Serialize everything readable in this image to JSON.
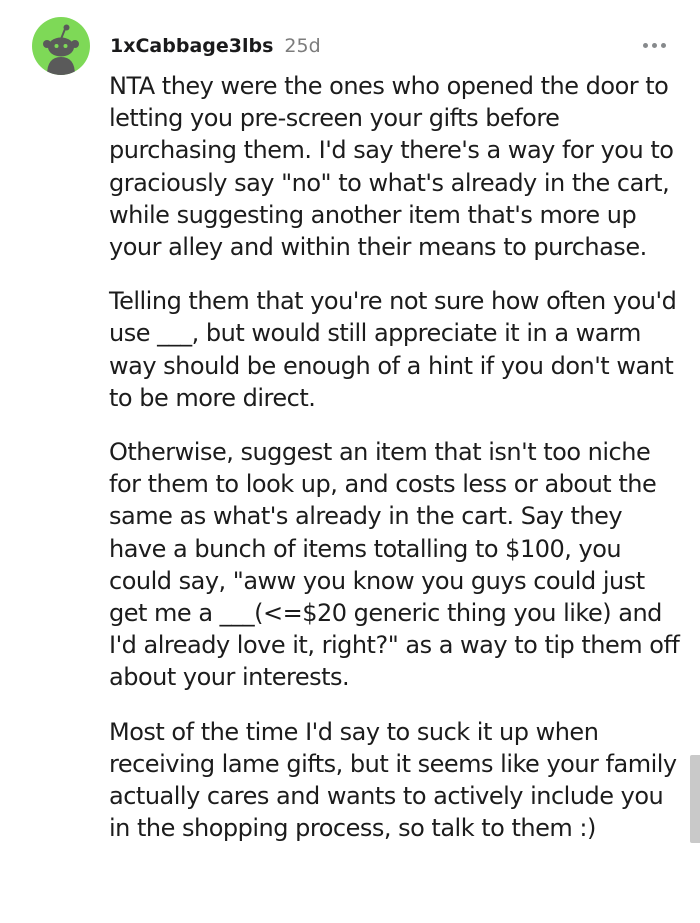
{
  "comment": {
    "username": "1xCabbage3lbs",
    "timestamp": "25d",
    "avatar_icon": "snoo-avatar-icon",
    "avatar_color": "#7ed957",
    "more_icon": "more-options-icon",
    "paragraphs": [
      "NTA they were the ones who opened the door to letting you pre-screen your gifts before purchasing them. I'd say there's a way for you to graciously say \"no\" to what's already in the cart, while suggesting another item that's more up your alley and within their means to purchase.",
      "Telling them that you're not sure how often you'd use ___, but would still appreciate it in a warm way should be enough of a hint if you don't want to be more direct.",
      "Otherwise, suggest an item that isn't too niche for them to look up, and costs less or about the same as what's already in the cart. Say they have a bunch of items totalling to $100, you could say, \"aww you know you guys could just get me a ___(<=$20 generic thing you like) and I'd already love it, right?\" as a way to tip them off about your interests.",
      "Most of the time I'd say to suck it up when receiving lame gifts, but it seems like your family actually cares and wants to actively include you in the shopping process, so talk to them :)"
    ]
  }
}
